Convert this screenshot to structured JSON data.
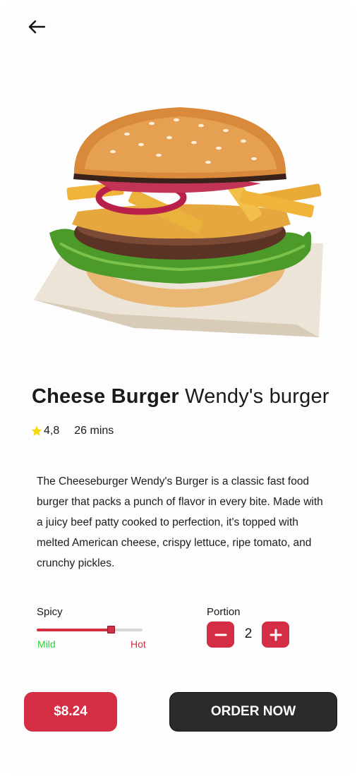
{
  "header": {
    "back_icon": "arrow-left-icon"
  },
  "product": {
    "image_icon": "cheese-burger-image",
    "name_bold": "Cheese Burger",
    "name_light": "Wendy's burger",
    "rating": "4,8",
    "rating_icon": "star-icon",
    "time": "26 mins",
    "description": "The Cheeseburger Wendy's Burger is a classic fast food burger that packs a punch of flavor in every bite. Made with a juicy beef patty cooked to perfection, it's topped with melted American cheese, crispy lettuce, ripe tomato, and crunchy pickles."
  },
  "spicy": {
    "label": "Spicy",
    "min_label": "Mild",
    "max_label": "Hot",
    "level": 0.7
  },
  "portion": {
    "label": "Portion",
    "quantity": "2",
    "minus_icon": "minus-icon",
    "plus_icon": "plus-icon"
  },
  "footer": {
    "price": "$8.24",
    "order_label": "ORDER NOW"
  },
  "colors": {
    "accent": "#d42e45",
    "dark": "#2b2a2d",
    "mild": "#2fcf3a",
    "star": "#f5d90a"
  }
}
